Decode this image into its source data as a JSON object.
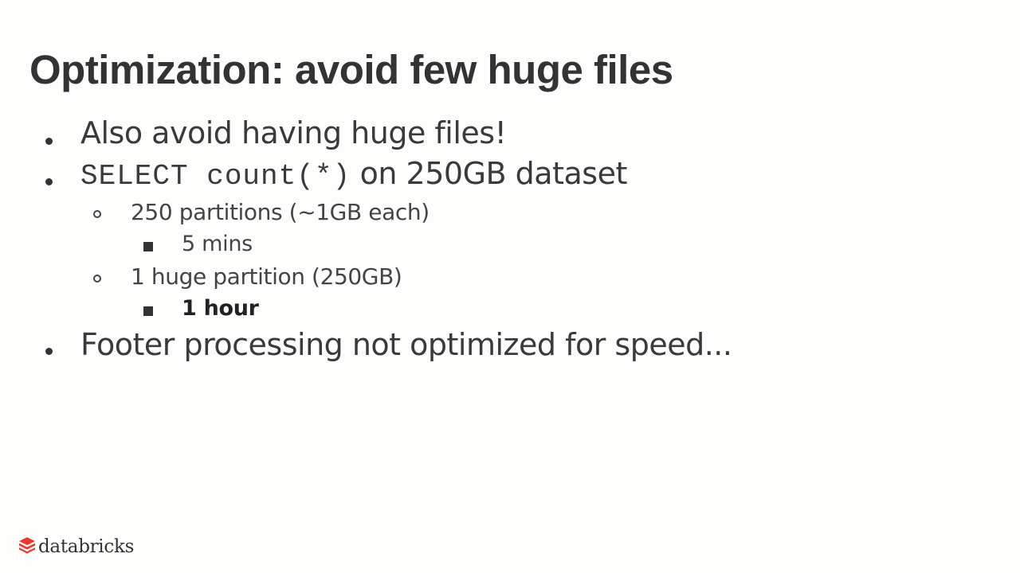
{
  "slide": {
    "title": "Optimization: avoid few huge files",
    "bullets": [
      {
        "text": "Also avoid having huge files!"
      },
      {
        "code": "SELECT count(*)",
        "text": " on 250GB dataset"
      },
      {
        "text": "250 partitions (~1GB each)"
      },
      {
        "text": "5 mins"
      },
      {
        "text": "1 huge partition (250GB)"
      },
      {
        "text": "1 hour"
      },
      {
        "text": "Footer processing not optimized for speed..."
      }
    ]
  },
  "logo": {
    "text": "databricks",
    "icon": "databricks-logo-icon",
    "color": "#e8382f"
  }
}
